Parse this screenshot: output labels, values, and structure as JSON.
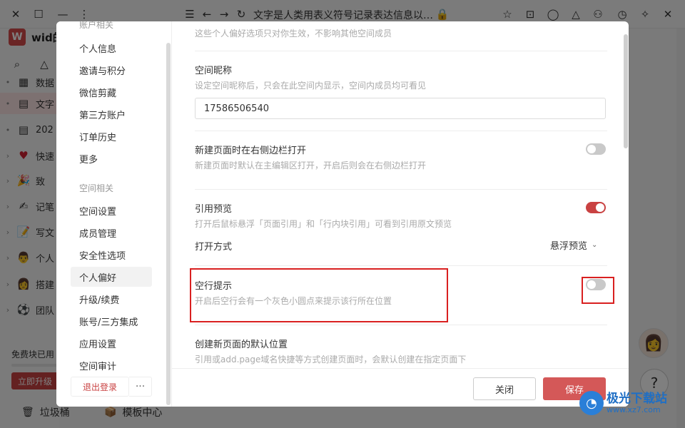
{
  "window": {
    "doc_title": "文字是人类用表义符号记录表达信息以…",
    "controls": [
      "close-icon",
      "maximize-icon",
      "minimize-icon",
      "more-vertical-icon"
    ]
  },
  "workspace": {
    "logo_letter": "W",
    "name": "wid的"
  },
  "sidebar": {
    "items": [
      {
        "label": "数据",
        "icon": "table-icon"
      },
      {
        "label": "文字",
        "icon": "doc-icon",
        "active": true
      },
      {
        "label": "202",
        "icon": "doc-icon"
      },
      {
        "label": "快速",
        "icon": "heart-icon"
      },
      {
        "label": "致",
        "icon": "party-icon"
      },
      {
        "label": "记笔",
        "icon": "pen-icon"
      },
      {
        "label": "写文",
        "icon": "writing-icon"
      },
      {
        "label": "个人",
        "icon": "person-icon"
      },
      {
        "label": "搭建",
        "icon": "woman-icon"
      },
      {
        "label": "团队",
        "icon": "soccer-icon"
      }
    ],
    "free_text": "免费块已用",
    "upgrade_label": "立即升级",
    "trash_label": "垃圾桶",
    "template_label": "模板中心"
  },
  "modal": {
    "nav": {
      "group_account": "账户相关",
      "account_items": [
        "个人信息",
        "邀请与积分",
        "微信剪藏",
        "第三方账户",
        "订单历史",
        "更多"
      ],
      "group_space": "空间相关",
      "space_items": [
        "空间设置",
        "成员管理",
        "安全性选项",
        "个人偏好",
        "升级/续费",
        "账号/三方集成",
        "应用设置",
        "空间审计"
      ],
      "selected": "个人偏好",
      "logout_label": "退出登录",
      "more_label": "···"
    },
    "body": {
      "top_desc": "这些个人偏好选项只对你生效，不影响其他空间成员",
      "nickname": {
        "label": "空间昵称",
        "desc": "设定空间昵称后，只会在此空间内显示，空间内成员均可看见",
        "value": "17586506540"
      },
      "new_page_sidebar": {
        "label": "新建页面时在右侧边栏打开",
        "desc": "新建页面时默认在主编辑区打开，开启后则会在右侧边栏打开",
        "enabled": false
      },
      "quote_preview": {
        "label": "引用预览",
        "desc": "打开后鼠标悬浮「页面引用」和「行内块引用」可看到引用原文预览",
        "enabled": true,
        "open_mode_label": "打开方式",
        "open_mode_value": "悬浮预览"
      },
      "empty_line_hint": {
        "label": "空行提示",
        "desc": "开启后空行会有一个灰色小圆点来提示该行所在位置",
        "enabled": false
      },
      "new_page_location": {
        "label": "创建新页面的默认位置",
        "desc": "引用或add.page域名快捷等方式创建页面时，会默认创建在指定页面下"
      }
    },
    "footer": {
      "close_label": "关闭",
      "save_label": "保存"
    }
  },
  "watermark": {
    "name": "极光下载站",
    "url": "www.xz7.com"
  },
  "colors": {
    "accent": "#c94242",
    "highlight_box": "#d92020",
    "save_button": "#d45858"
  }
}
